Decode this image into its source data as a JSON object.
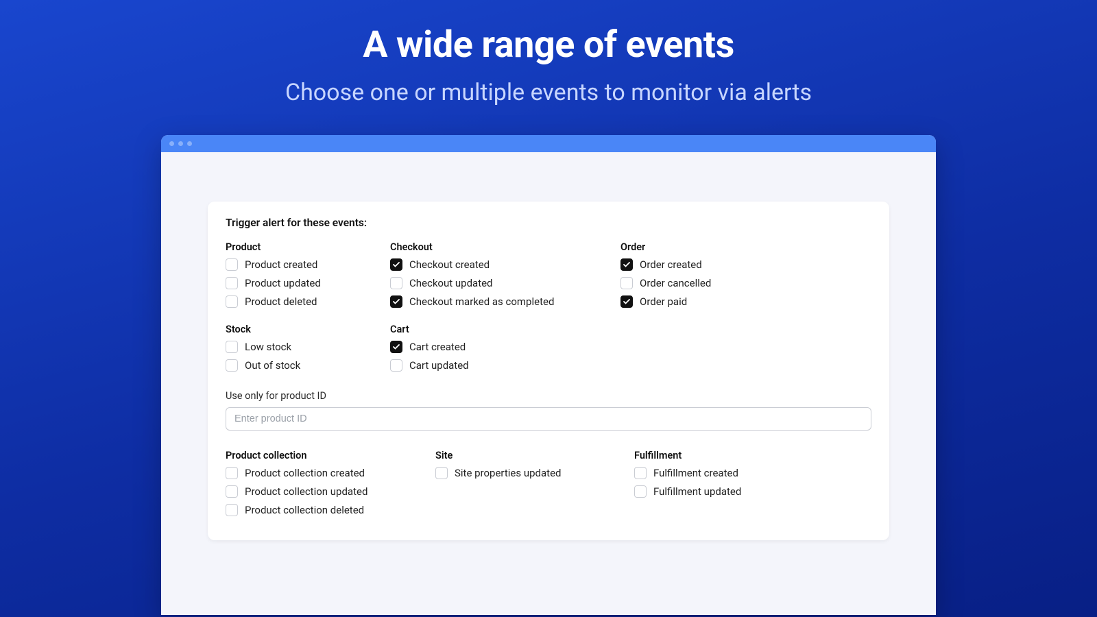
{
  "hero": {
    "title": "A wide range of events",
    "subtitle": "Choose one or multiple events to monitor via alerts"
  },
  "card": {
    "title": "Trigger alert for these events:",
    "groups_top": {
      "product": {
        "title": "Product",
        "items": [
          {
            "label": "Product created",
            "checked": false
          },
          {
            "label": "Product updated",
            "checked": false
          },
          {
            "label": "Product deleted",
            "checked": false
          }
        ]
      },
      "checkout": {
        "title": "Checkout",
        "items": [
          {
            "label": "Checkout created",
            "checked": true
          },
          {
            "label": "Checkout updated",
            "checked": false
          },
          {
            "label": "Checkout marked as completed",
            "checked": true
          }
        ]
      },
      "order": {
        "title": "Order",
        "items": [
          {
            "label": "Order created",
            "checked": true
          },
          {
            "label": "Order cancelled",
            "checked": false
          },
          {
            "label": "Order paid",
            "checked": true
          }
        ]
      },
      "stock": {
        "title": "Stock",
        "items": [
          {
            "label": "Low stock",
            "checked": false
          },
          {
            "label": "Out of stock",
            "checked": false
          }
        ]
      },
      "cart": {
        "title": "Cart",
        "items": [
          {
            "label": "Cart created",
            "checked": true
          },
          {
            "label": "Cart updated",
            "checked": false
          }
        ]
      }
    },
    "product_id": {
      "label": "Use only for product ID",
      "placeholder": "Enter product ID",
      "value": ""
    },
    "groups_bottom": {
      "collection": {
        "title": "Product collection",
        "items": [
          {
            "label": "Product collection created",
            "checked": false
          },
          {
            "label": "Product collection updated",
            "checked": false
          },
          {
            "label": "Product collection deleted",
            "checked": false
          }
        ]
      },
      "site": {
        "title": "Site",
        "items": [
          {
            "label": "Site properties updated",
            "checked": false
          }
        ]
      },
      "fulfillment": {
        "title": "Fulfillment",
        "items": [
          {
            "label": "Fulfillment created",
            "checked": false
          },
          {
            "label": "Fulfillment updated",
            "checked": false
          }
        ]
      }
    }
  }
}
